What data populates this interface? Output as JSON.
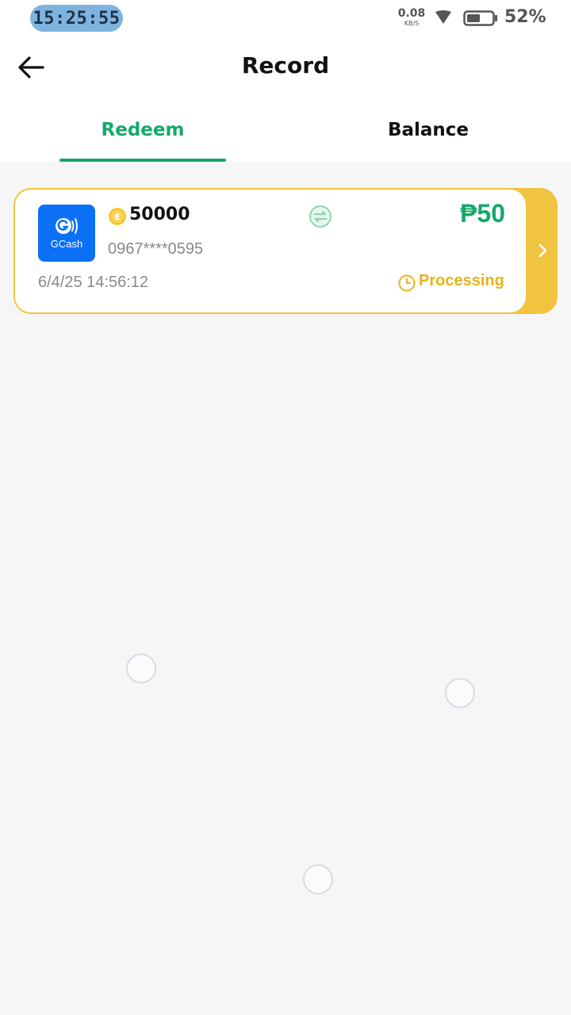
{
  "status_bar": {
    "time": "15:25:55",
    "net_speed_value": "0.08",
    "net_speed_unit": "KB/S",
    "battery_percent": "52%",
    "battery_level": 0.52,
    "icons": [
      "wifi-icon",
      "battery-icon"
    ]
  },
  "header": {
    "title": "Record",
    "back_icon": "arrow-left-icon"
  },
  "tabs": [
    {
      "label": "Redeem",
      "active": true
    },
    {
      "label": "Balance",
      "active": false
    }
  ],
  "colors": {
    "accent_green": "#13a96a",
    "card_accent_yellow": "#f1c440",
    "status_processing": "#e9b21b",
    "gcash_blue": "#0a70f5"
  },
  "records": [
    {
      "provider_logo_text": "GCash",
      "coins": "50000",
      "amount": "₱50",
      "account": "0967****0595",
      "datetime": "6/4/25 14:56:12",
      "status": "Processing",
      "icons": [
        "coin-icon",
        "exchange-icon",
        "clock-icon",
        "chevron-right-icon"
      ]
    }
  ]
}
